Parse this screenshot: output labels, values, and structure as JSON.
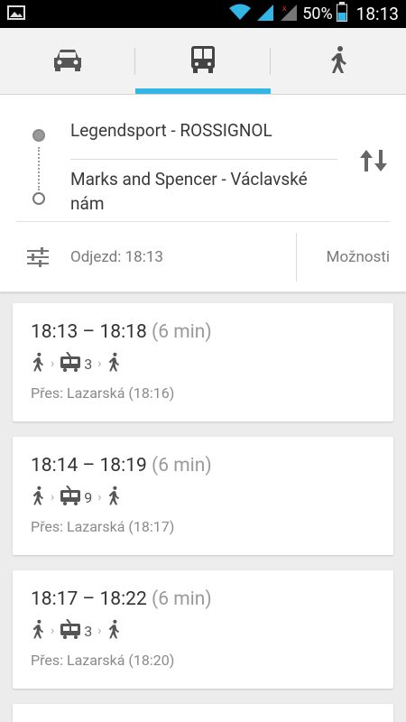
{
  "statusbar": {
    "battery_percent": "50%",
    "time": "18:13"
  },
  "modes": [
    {
      "name": "car",
      "icon": "car-icon",
      "selected": false
    },
    {
      "name": "transit",
      "icon": "bus-icon",
      "selected": true
    },
    {
      "name": "walk",
      "icon": "walk-icon",
      "selected": false
    }
  ],
  "route": {
    "from": "Legendsport - ROSSIGNOL",
    "to": "Marks and Spencer - Václavské nám",
    "depart_label": "Odjezd: 18:13",
    "options_label": "Možnosti"
  },
  "results": [
    {
      "times": "18:13 – 18:18",
      "duration": "(6 min)",
      "line": "3",
      "via": "Přes: Lazarská (18:16)"
    },
    {
      "times": "18:14 – 18:19",
      "duration": "(6 min)",
      "line": "9",
      "via": "Přes: Lazarská (18:17)"
    },
    {
      "times": "18:17 – 18:22",
      "duration": "(6 min)",
      "line": "3",
      "via": "Přes: Lazarská (18:20)"
    }
  ],
  "colors": {
    "accent": "#33b5e5"
  }
}
